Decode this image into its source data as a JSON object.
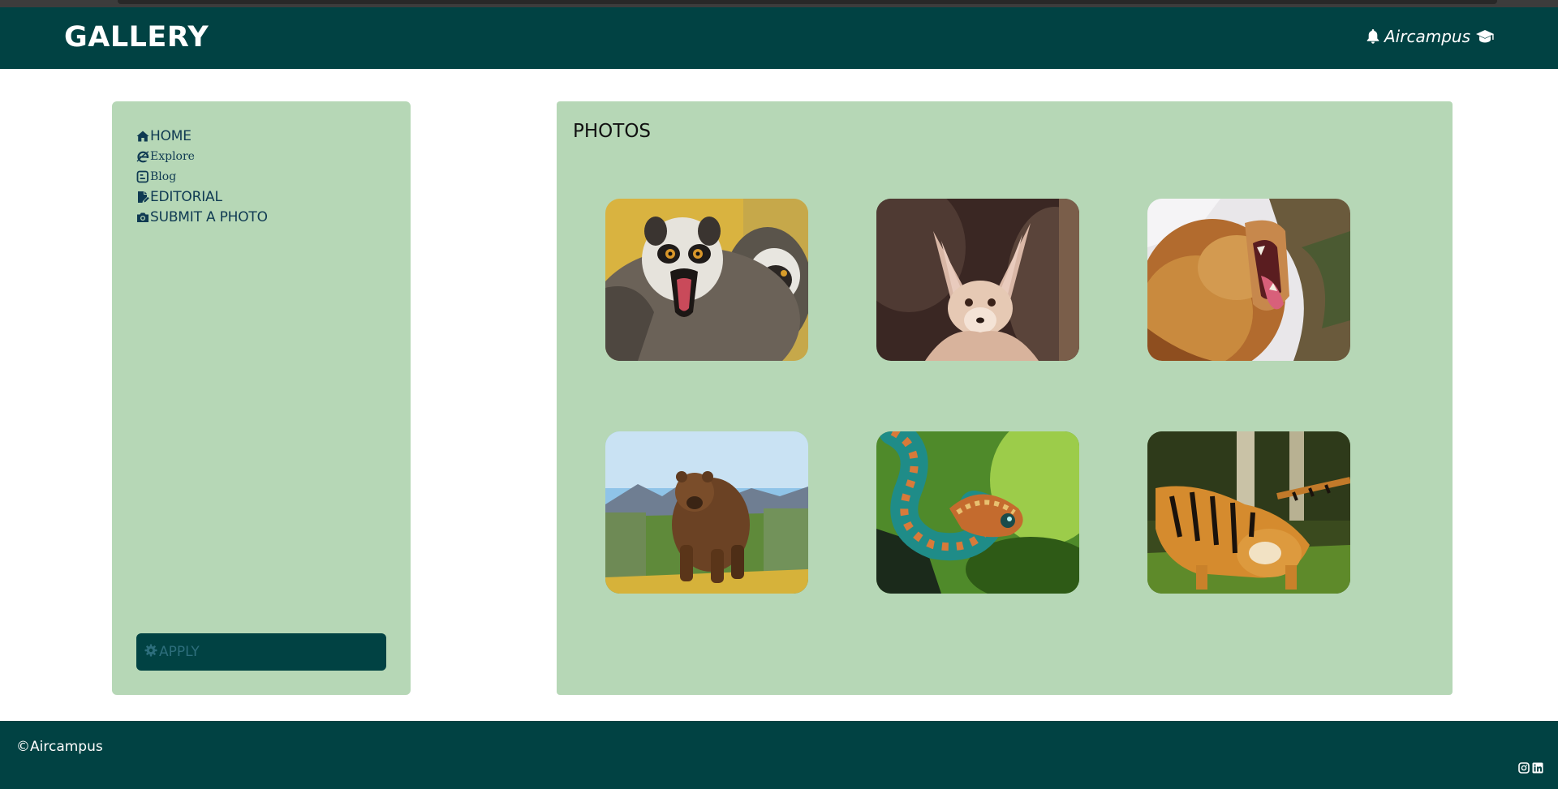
{
  "header": {
    "brand": "GALLERY",
    "user_name": "Aircampus",
    "icons": [
      "bell-icon",
      "graduation-cap-icon"
    ]
  },
  "sidebar": {
    "items": [
      {
        "label": "HOME",
        "icon": "home-icon"
      },
      {
        "label": "Explore",
        "icon": "internet-explorer-icon"
      },
      {
        "label": "Blog",
        "icon": "blogger-icon"
      },
      {
        "label": "EDITORIAL",
        "icon": "file-edit-icon"
      },
      {
        "label": "SUBMIT A PHOTO",
        "icon": "camera-icon"
      }
    ],
    "apply_label": "APPLY",
    "apply_icon": "gear-icon"
  },
  "main": {
    "title": "PHOTOS",
    "photos": [
      {
        "subject": "lemurs"
      },
      {
        "subject": "fennec fox"
      },
      {
        "subject": "lion yawning"
      },
      {
        "subject": "brown bear"
      },
      {
        "subject": "bush viper snake"
      },
      {
        "subject": "tiger"
      }
    ]
  },
  "footer": {
    "copyright": "©Aircampus",
    "social_icons": [
      "instagram-icon",
      "linkedin-icon"
    ]
  },
  "colors": {
    "header_bg": "#014243",
    "panel_bg": "#b6d7b6",
    "nav_text": "#0f3a52",
    "apply_bg": "#014243"
  }
}
